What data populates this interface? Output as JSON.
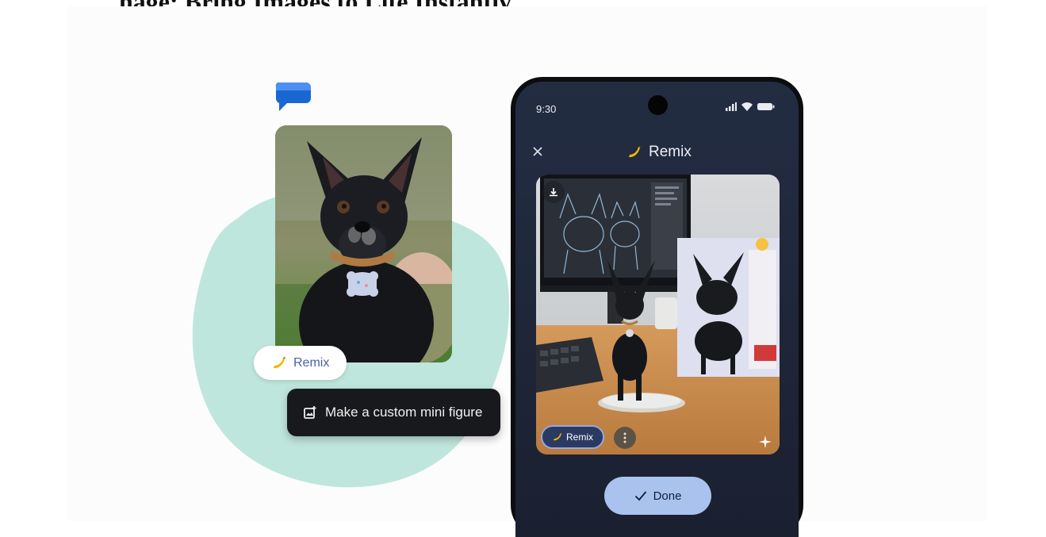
{
  "headline": "nage: Bring Images to Life Instantly",
  "message_card": {
    "chip_remix_label": "Remix",
    "action_label": "Make a custom mini figure"
  },
  "phone": {
    "status_time": "9:30",
    "title": "Remix",
    "remix_chip_label": "Remix",
    "done_label": "Done"
  },
  "colors": {
    "blob": "#bfe6dc",
    "phone_screen": "#232d42",
    "done_button": "#a9c2ee",
    "chip_dark": "#17191c",
    "messages_icon": "#1967d2"
  },
  "icons": {
    "messages": "messages-bubble-icon",
    "banana": "banana-icon",
    "image_add": "image-add-icon",
    "close": "close-icon",
    "download": "download-icon",
    "more": "more-vertical-icon",
    "sparkle": "sparkle-icon",
    "check": "check-icon",
    "signal": "signal-icon",
    "wifi": "wifi-icon",
    "battery": "battery-icon"
  }
}
